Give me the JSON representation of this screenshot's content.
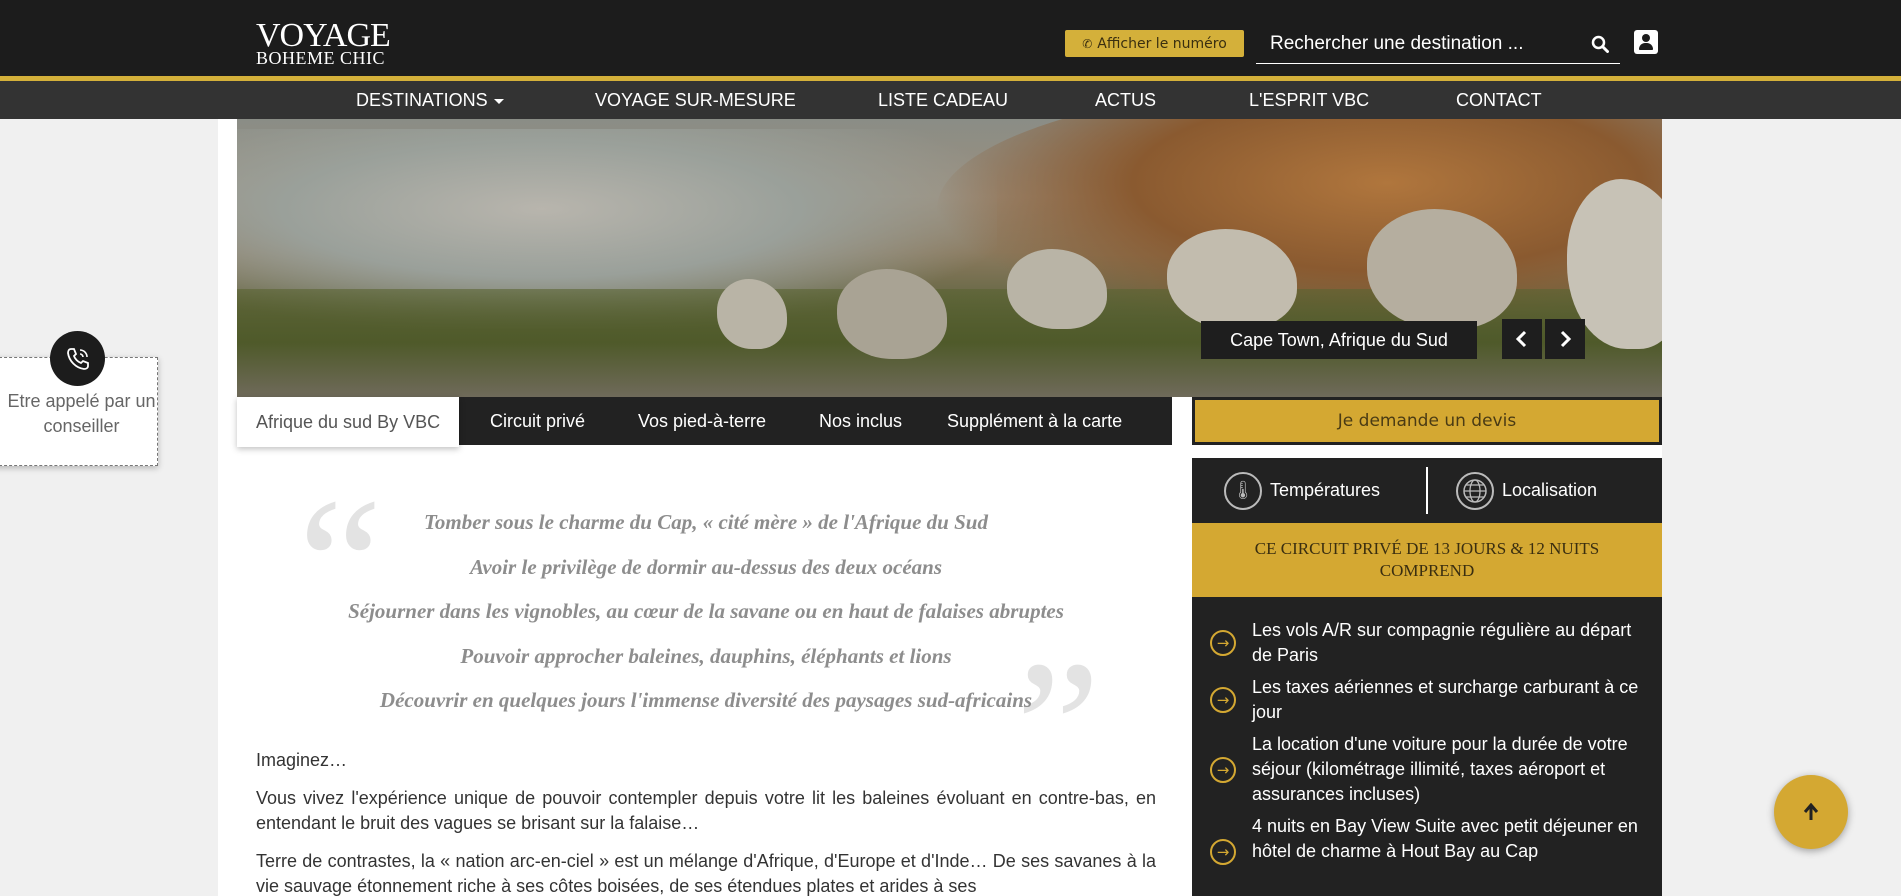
{
  "header": {
    "logo_line1": "VOYAGE",
    "logo_line2": "BOHEME CHIC",
    "phone_button": "Afficher le numéro",
    "search_placeholder": "Rechercher une destination ...",
    "icons": [
      "phone-icon",
      "search-icon",
      "account-icon"
    ]
  },
  "nav": {
    "items": [
      "DESTINATIONS",
      "VOYAGE SUR-MESURE",
      "LISTE CADEAU",
      "ACTUS",
      "L'ESPRIT VBC",
      "CONTACT"
    ]
  },
  "hero": {
    "caption": "Cape Town, Afrique du Sud",
    "prev_arrow": "‹",
    "next_arrow": "›"
  },
  "tabs": {
    "items": [
      "Afrique du sud By VBC",
      "Circuit privé",
      "Vos pied-à-terre",
      "Nos inclus",
      "Supplément à la carte"
    ],
    "active_index": 0,
    "cta": "Je demande un devis"
  },
  "call_widget": {
    "text": "Etre appelé par un conseiller"
  },
  "quotes": [
    "Tomber sous le charme du Cap, « cité mère » de l'Afrique du Sud",
    "Avoir le privilège de dormir au-dessus des deux océans",
    "Séjourner dans les vignobles, au cœur de la savane ou en haut de falaises abruptes",
    "Pouvoir approcher baleines, dauphins, éléphants et lions",
    "Découvrir en quelques jours l'immense diversité des paysages sud-africains"
  ],
  "body": {
    "p1": "Imaginez…",
    "p2": "Vous vivez l'expérience unique de pouvoir contempler depuis votre lit les baleines évoluant en contre-bas, en entendant le bruit des vagues se brisant sur la falaise…",
    "p3": "Terre de contrastes, la « nation arc-en-ciel » est un mélange d'Afrique, d'Europe et d'Inde… De ses savanes à la vie sauvage étonnement riche à ses côtes boisées, de ses étendues plates et arides à ses"
  },
  "sidebar": {
    "tab_temperatures": "Températures",
    "tab_localisation": "Localisation",
    "heading": "CE CIRCUIT PRIVÉ DE 13 JOURS & 12 NUITS COMPREND",
    "items": [
      "Les vols A/R sur compagnie régulière au départ de Paris",
      "Les taxes aériennes et surcharge carburant à ce jour",
      "La location d'une voiture pour la durée de votre séjour (kilométrage illimité, taxes aéroport et assurances incluses)",
      "4 nuits en Bay View Suite avec petit déjeuner en hôtel de charme à Hout Bay au Cap"
    ]
  },
  "colors": {
    "gold": "#d4a832",
    "dark": "#1c1c1c",
    "nav": "#333333"
  }
}
